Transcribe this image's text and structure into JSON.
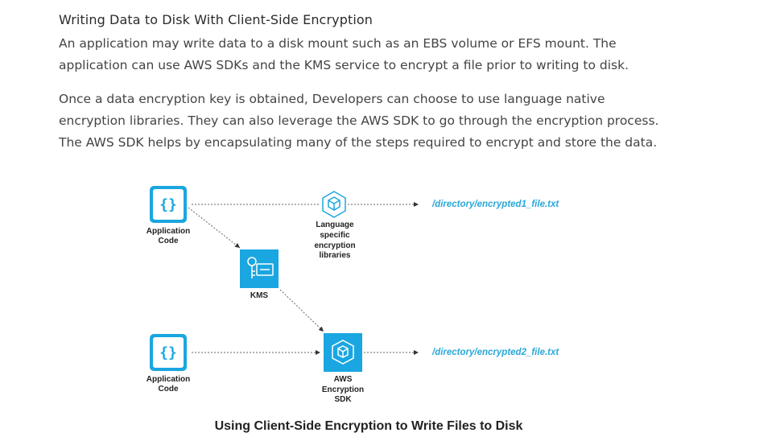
{
  "section": {
    "heading": "Writing Data to Disk With Client-Side Encryption",
    "paragraph1": "An application may write data to a disk mount such as an EBS volume or EFS mount. The application can use AWS SDKs and the KMS service to encrypt a file prior to writing to disk.",
    "paragraph2": "Once a data encryption key is obtained, Developers can choose to use language native encryption libraries. They can also leverage the AWS SDK to go through the encryption process. The AWS SDK helps by encapsulating many of the steps required to encrypt and store the data."
  },
  "diagram": {
    "app_top_label_1": "Application",
    "app_top_label_2": "Code",
    "app_bottom_label_1": "Application",
    "app_bottom_label_2": "Code",
    "kms_label": "KMS",
    "lang_lib_label_1": "Language",
    "lang_lib_label_2": "specific",
    "lang_lib_label_3": "encryption",
    "lang_lib_label_4": "libraries",
    "sdk_label_1": "AWS",
    "sdk_label_2": "Encryption",
    "sdk_label_3": "SDK",
    "file1": "/directory/encrypted1_file.txt",
    "file2": "/directory/encrypted2_file.txt",
    "icons": {
      "app_icon": "curly-braces-icon",
      "kms_icon": "key-icon",
      "lib_icon": "cube-icon"
    },
    "colors": {
      "accent": "#1aa6e0",
      "path_text": "#2aa8d8"
    }
  },
  "caption": "Using Client-Side Encryption to Write Files to Disk"
}
